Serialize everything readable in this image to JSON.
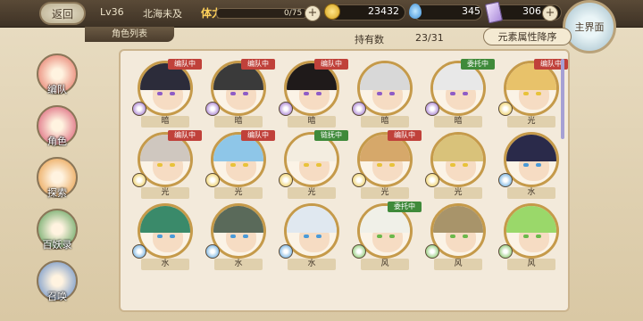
{
  "header": {
    "back_label": "返回",
    "level": "Lv36",
    "player_name": "北海未及",
    "stamina_label": "体力",
    "stamina_text": "0/75",
    "stamina_fraction": 0.0,
    "gold": "23432",
    "gems": "345",
    "cards": "306",
    "main_label": "主界面"
  },
  "subtab": "角色列表",
  "owned": {
    "label": "持有数",
    "value": "23/31"
  },
  "sort_label": "元素属性降序",
  "sidebar": [
    {
      "label": "编队",
      "color": "#e36a5a"
    },
    {
      "label": "角色",
      "color": "#d64d6a"
    },
    {
      "label": "探索",
      "color": "#e6953a"
    },
    {
      "label": "百妖录",
      "color": "#4f9a4f"
    },
    {
      "label": "召唤",
      "color": "#5a86c5"
    }
  ],
  "characters": [
    {
      "element": "暗",
      "status": "编队中",
      "hair": "#2c2c3a",
      "badge": "#8e5cc6"
    },
    {
      "element": "暗",
      "status": "编队中",
      "hair": "#3a3a3a",
      "badge": "#8e5cc6"
    },
    {
      "element": "暗",
      "status": "编队中",
      "hair": "#1f1a1a",
      "badge": "#8e5cc6"
    },
    {
      "element": "暗",
      "status": "",
      "hair": "#d8d8d8",
      "badge": "#8e5cc6"
    },
    {
      "element": "暗",
      "status": "委托中",
      "hair": "#e8e8e8",
      "badge": "#8e5cc6"
    },
    {
      "element": "光",
      "status": "编队中",
      "hair": "#e8c26a",
      "badge": "#e8c23a"
    },
    {
      "element": "光",
      "status": "编队中",
      "hair": "#cfc7bf",
      "badge": "#e8c23a"
    },
    {
      "element": "光",
      "status": "编队中",
      "hair": "#8ec6e8",
      "badge": "#e8c23a"
    },
    {
      "element": "光",
      "status": "链抚中",
      "hair": "#f3ede0",
      "badge": "#e8c23a"
    },
    {
      "element": "光",
      "status": "编队中",
      "hair": "#d6a86a",
      "badge": "#e8c23a"
    },
    {
      "element": "光",
      "status": "",
      "hair": "#d9c27a",
      "badge": "#e8c23a"
    },
    {
      "element": "水",
      "status": "",
      "hair": "#2a2a4a",
      "badge": "#4a9ad8"
    },
    {
      "element": "水",
      "status": "",
      "hair": "#3a8a6a",
      "badge": "#4a9ad8"
    },
    {
      "element": "水",
      "status": "",
      "hair": "#5a6a5a",
      "badge": "#4a9ad8"
    },
    {
      "element": "水",
      "status": "",
      "hair": "#e0e8f0",
      "badge": "#4a9ad8"
    },
    {
      "element": "风",
      "status": "委托中",
      "hair": "#f0f0e8",
      "badge": "#6ab84a"
    },
    {
      "element": "风",
      "status": "",
      "hair": "#a8946a",
      "badge": "#6ab84a"
    },
    {
      "element": "风",
      "status": "",
      "hair": "#9ad86a",
      "badge": "#6ab84a"
    }
  ],
  "colors": {
    "status_team": "#c0413a",
    "status_commission": "#3f8a3a",
    "status_link": "#3f8a3a"
  }
}
